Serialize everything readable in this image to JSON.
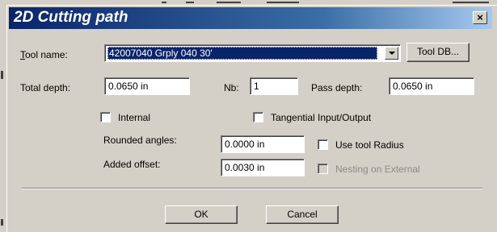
{
  "dialog": {
    "title": "2D Cutting path"
  },
  "tool": {
    "label_prefix": "T",
    "label_rest": "ool name:",
    "selected": "42007040 Grply 040 30'",
    "db_button": "Tool DB..."
  },
  "depth": {
    "total_label": "Total depth:",
    "total_value": "0.0650 in",
    "nb_label": "Nb:",
    "nb_value": "1",
    "pass_label": "Pass depth:",
    "pass_value": "0.0650 in"
  },
  "options": {
    "internal_label": "Internal",
    "internal_checked": false,
    "tangential_label": "Tangential Input/Output",
    "tangential_checked": false,
    "rounded_label": "Rounded angles:",
    "rounded_value": "0.0000 in",
    "use_radius_label": "Use tool Radius",
    "use_radius_checked": false,
    "offset_label": "Added offset:",
    "offset_value": "0.0030 in",
    "nesting_label": "Nesting on External",
    "nesting_checked": false,
    "nesting_enabled": false
  },
  "buttons": {
    "ok": "OK",
    "cancel": "Cancel"
  },
  "colors": {
    "titlebar_start": "#0a246a",
    "titlebar_end": "#a6caf0",
    "face": "#d4d0c8",
    "selection": "#0a246a"
  },
  "icons": {
    "close": "close-icon",
    "dropdown": "chevron-down-icon"
  }
}
